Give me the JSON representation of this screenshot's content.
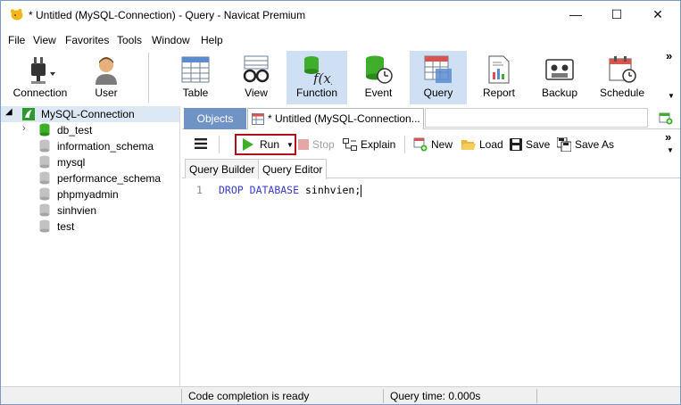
{
  "window": {
    "title": "* Untitled (MySQL-Connection) - Query - Navicat Premium",
    "minimize": "—",
    "maximize": "☐",
    "close": "✕"
  },
  "menu": [
    "File",
    "View",
    "Favorites",
    "Tools",
    "Window",
    "Help"
  ],
  "toolbar": {
    "items": [
      {
        "label": "Connection",
        "icon": "connection-plug-icon"
      },
      {
        "label": "User",
        "icon": "user-icon"
      },
      {
        "label": "Table",
        "icon": "table-icon"
      },
      {
        "label": "View",
        "icon": "view-glasses-icon"
      },
      {
        "label": "Function",
        "icon": "function-icon",
        "selected": true
      },
      {
        "label": "Event",
        "icon": "event-icon"
      },
      {
        "label": "Query",
        "icon": "query-icon",
        "selected": true
      },
      {
        "label": "Report",
        "icon": "report-icon"
      },
      {
        "label": "Backup",
        "icon": "backup-icon"
      },
      {
        "label": "Schedule",
        "icon": "schedule-icon"
      }
    ],
    "overflow": "»"
  },
  "sidebar": {
    "connection": "MySQL-Connection",
    "databases": [
      "db_test",
      "information_schema",
      "mysql",
      "performance_schema",
      "phpmyadmin",
      "sinhvien",
      "test"
    ]
  },
  "tabs": {
    "objects": "Objects",
    "document": "* Untitled (MySQL-Connection..."
  },
  "query_toolbar": {
    "run": "Run",
    "stop": "Stop",
    "explain": "Explain",
    "new": "New",
    "load": "Load",
    "save": "Save",
    "save_as": "Save As",
    "overflow": "»"
  },
  "subtabs": [
    "Query Builder",
    "Query Editor"
  ],
  "editor": {
    "line_number": "1",
    "kw1": "DROP",
    "kw2": "DATABASE",
    "ident": "sinhvien;"
  },
  "status": {
    "left": "Code completion is ready",
    "right": "Query time: 0.000s"
  },
  "colors": {
    "accent": "#6f93c4",
    "selected_bg": "#cfe0f4",
    "run_highlight": "#b0101a",
    "keyword": "#3a3acb",
    "db_icon_green": "#3fae2a"
  }
}
